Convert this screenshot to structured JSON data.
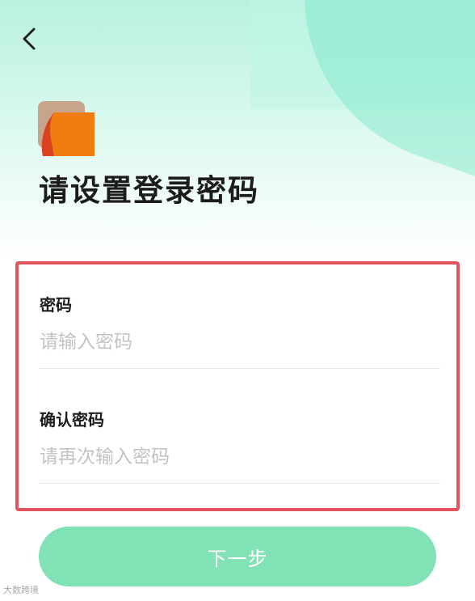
{
  "header": {
    "back_icon": "chevron-left-icon",
    "logo_icon": "app-logo-icon",
    "title": "请设置登录密码"
  },
  "form": {
    "password": {
      "label": "密码",
      "placeholder": "请输入密码",
      "value": ""
    },
    "confirm_password": {
      "label": "确认密码",
      "placeholder": "请再次输入密码",
      "value": ""
    }
  },
  "actions": {
    "next_label": "下一步"
  },
  "watermark": "大数跨境",
  "colors": {
    "accent": "#80e2b5",
    "highlight_border": "#e2555e",
    "background_top": "#b8f1e0",
    "title_text": "#1c1c1c",
    "placeholder_text": "#c3c3c3"
  }
}
